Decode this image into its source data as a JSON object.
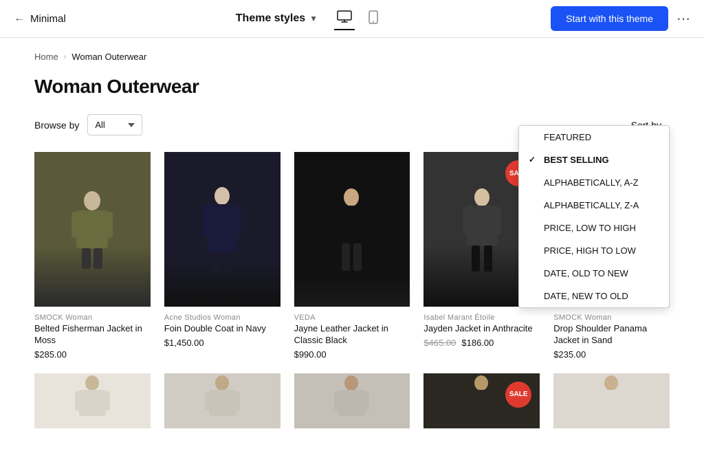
{
  "header": {
    "back_icon": "←",
    "store_name": "Minimal",
    "theme_styles_label": "Theme styles",
    "chevron": "▾",
    "device_desktop": "🖥",
    "device_mobile": "📱",
    "start_btn_label": "Start with this theme",
    "more_icon": "⋯"
  },
  "breadcrumb": {
    "home": "Home",
    "separator": "›",
    "current": "Woman Outerwear"
  },
  "page": {
    "title": "Woman Outerwear"
  },
  "filter": {
    "browse_label": "Browse by",
    "browse_value": "All",
    "sort_label": "Sort by",
    "sort_options": [
      {
        "value": "featured",
        "label": "FEATURED",
        "selected": false
      },
      {
        "value": "best_selling",
        "label": "BEST SELLING",
        "selected": true
      },
      {
        "value": "alpha_az",
        "label": "ALPHABETICALLY, A-Z",
        "selected": false
      },
      {
        "value": "alpha_za",
        "label": "ALPHABETICALLY, Z-A",
        "selected": false
      },
      {
        "value": "price_low_high",
        "label": "PRICE, LOW TO HIGH",
        "selected": false
      },
      {
        "value": "price_high_low",
        "label": "PRICE, HIGH TO LOW",
        "selected": false
      },
      {
        "value": "date_old_new",
        "label": "DATE, OLD TO NEW",
        "selected": false
      },
      {
        "value": "date_new_old",
        "label": "DATE, NEW TO OLD",
        "selected": false
      }
    ]
  },
  "products_row1": [
    {
      "id": 1,
      "name": "Belted Fisherman Jacket in Moss",
      "brand": "SMOCK Woman",
      "price": "$285.00",
      "sale": false,
      "figure_class": "figure-1"
    },
    {
      "id": 2,
      "name": "Foin Double Coat in Navy",
      "brand": "Acne Studios Woman",
      "price": "$1,450.00",
      "sale": false,
      "figure_class": "figure-2"
    },
    {
      "id": 3,
      "name": "Jayne Leather Jacket in Classic Black",
      "brand": "VEDA",
      "price": "$990.00",
      "sale": false,
      "figure_class": "figure-3"
    },
    {
      "id": 4,
      "name": "Jayden Jacket in Anthracite",
      "brand": "Isabel Marant Étoile",
      "price_original": "$465.00",
      "price_sale": "$186.00",
      "sale": true,
      "figure_class": "figure-4"
    },
    {
      "id": 5,
      "name": "Drop Shoulder Panama Jacket in Sand",
      "brand": "SMOCK Woman",
      "price": "$235.00",
      "sale": false,
      "figure_class": "figure-5"
    }
  ],
  "products_row2": [
    {
      "id": 6,
      "name": "",
      "brand": "",
      "price": "",
      "sale": false,
      "figure_class": "figure-6"
    },
    {
      "id": 7,
      "name": "",
      "brand": "",
      "price": "",
      "sale": false,
      "figure_class": "figure-7"
    },
    {
      "id": 8,
      "name": "",
      "brand": "",
      "price": "",
      "sale": false,
      "figure_class": "figure-8"
    },
    {
      "id": 9,
      "name": "",
      "brand": "",
      "price": "",
      "sale": true,
      "figure_class": "figure-9"
    },
    {
      "id": 10,
      "name": "",
      "brand": "",
      "price": "",
      "sale": false,
      "figure_class": "figure-10"
    }
  ]
}
